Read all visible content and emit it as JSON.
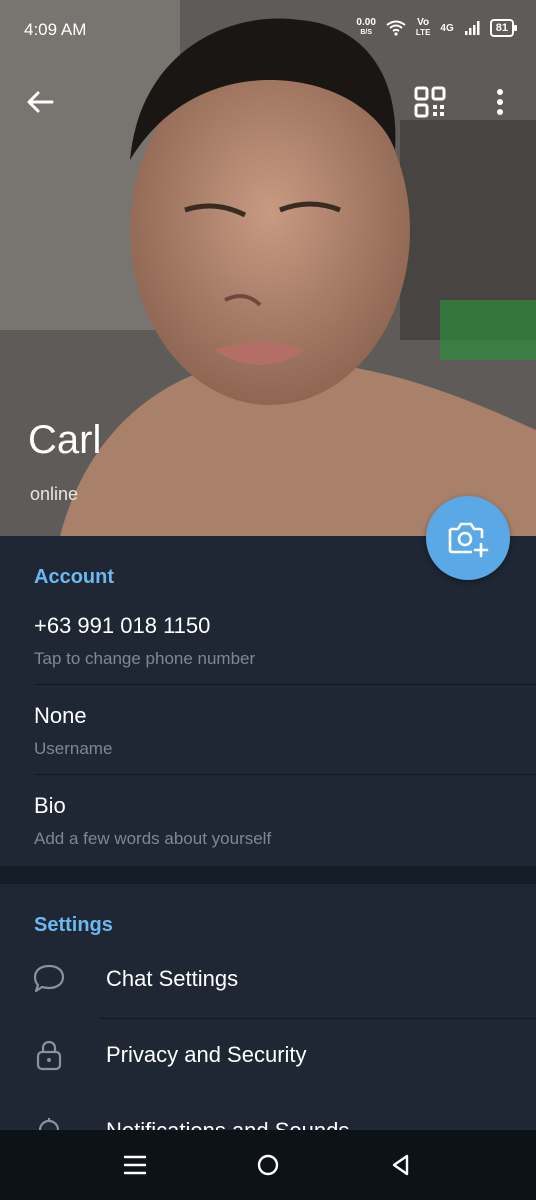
{
  "status_bar": {
    "time": "4:09 AM",
    "net_speed_value": "0.00",
    "net_speed_unit": "B/S",
    "volte_top": "Vo",
    "volte_bottom": "LTE",
    "network": "4G",
    "battery": "81"
  },
  "profile": {
    "name": "Carl",
    "status": "online"
  },
  "account": {
    "title": "Account",
    "phone": "+63 991 018 1150",
    "phone_hint": "Tap to change phone number",
    "username": "None",
    "username_label": "Username",
    "bio": "Bio",
    "bio_hint": "Add a few words about yourself"
  },
  "settings": {
    "title": "Settings",
    "items": [
      {
        "label": "Chat Settings",
        "icon": "chat-bubble-icon"
      },
      {
        "label": "Privacy and Security",
        "icon": "lock-icon"
      },
      {
        "label": "Notifications and Sounds",
        "icon": "bell-icon"
      }
    ]
  },
  "colors": {
    "accent": "#5aa8e6",
    "section_title": "#6cb8f0",
    "background": "#1e2733"
  }
}
